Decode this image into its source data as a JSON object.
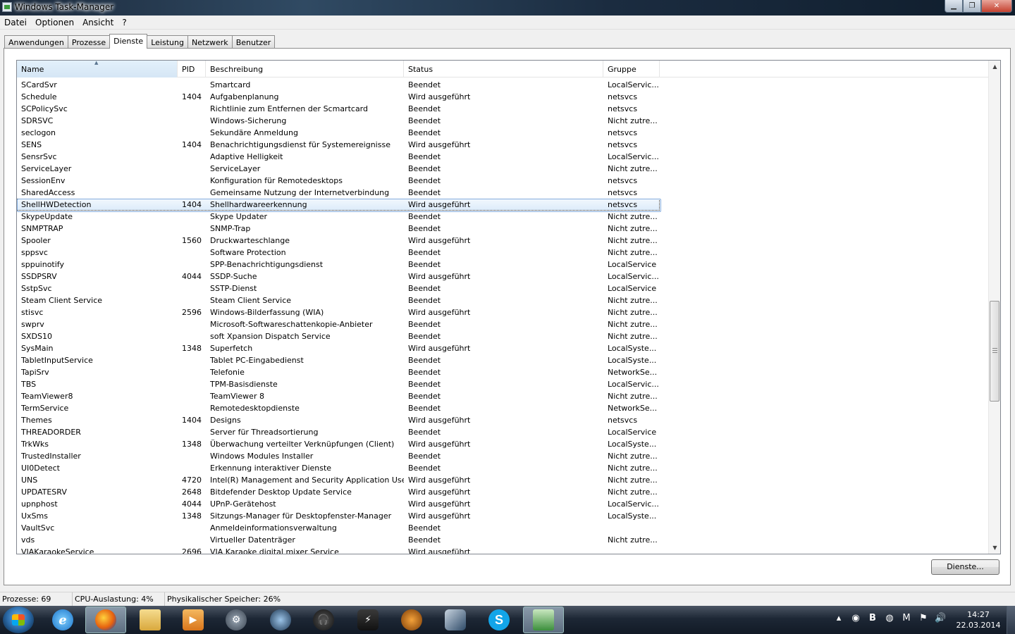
{
  "window": {
    "title": "Windows Task-Manager"
  },
  "menu": [
    "Datei",
    "Optionen",
    "Ansicht",
    "?"
  ],
  "tabs": [
    "Anwendungen",
    "Prozesse",
    "Dienste",
    "Leistung",
    "Netzwerk",
    "Benutzer"
  ],
  "active_tab": "Dienste",
  "columns": {
    "name": "Name",
    "pid": "PID",
    "desc": "Beschreibung",
    "status": "Status",
    "group": "Gruppe"
  },
  "services": [
    {
      "name": "SCardSvr",
      "pid": "",
      "desc": "Smartcard",
      "status": "Beendet",
      "group": "LocalServic..."
    },
    {
      "name": "Schedule",
      "pid": "1404",
      "desc": "Aufgabenplanung",
      "status": "Wird ausgeführt",
      "group": "netsvcs"
    },
    {
      "name": "SCPolicySvc",
      "pid": "",
      "desc": "Richtlinie zum Entfernen der Scmartcard",
      "status": "Beendet",
      "group": "netsvcs"
    },
    {
      "name": "SDRSVC",
      "pid": "",
      "desc": "Windows-Sicherung",
      "status": "Beendet",
      "group": "Nicht zutre..."
    },
    {
      "name": "seclogon",
      "pid": "",
      "desc": "Sekundäre Anmeldung",
      "status": "Beendet",
      "group": "netsvcs"
    },
    {
      "name": "SENS",
      "pid": "1404",
      "desc": "Benachrichtigungsdienst für Systemereignisse",
      "status": "Wird ausgeführt",
      "group": "netsvcs"
    },
    {
      "name": "SensrSvc",
      "pid": "",
      "desc": "Adaptive Helligkeit",
      "status": "Beendet",
      "group": "LocalServic..."
    },
    {
      "name": "ServiceLayer",
      "pid": "",
      "desc": "ServiceLayer",
      "status": "Beendet",
      "group": "Nicht zutre..."
    },
    {
      "name": "SessionEnv",
      "pid": "",
      "desc": "Konfiguration für Remotedesktops",
      "status": "Beendet",
      "group": "netsvcs"
    },
    {
      "name": "SharedAccess",
      "pid": "",
      "desc": "Gemeinsame Nutzung der Internetverbindung",
      "status": "Beendet",
      "group": "netsvcs"
    },
    {
      "name": "ShellHWDetection",
      "pid": "1404",
      "desc": "Shellhardwareerkennung",
      "status": "Wird ausgeführt",
      "group": "netsvcs",
      "selected": true
    },
    {
      "name": "SkypeUpdate",
      "pid": "",
      "desc": "Skype Updater",
      "status": "Beendet",
      "group": "Nicht zutre..."
    },
    {
      "name": "SNMPTRAP",
      "pid": "",
      "desc": "SNMP-Trap",
      "status": "Beendet",
      "group": "Nicht zutre..."
    },
    {
      "name": "Spooler",
      "pid": "1560",
      "desc": "Druckwarteschlange",
      "status": "Wird ausgeführt",
      "group": "Nicht zutre..."
    },
    {
      "name": "sppsvc",
      "pid": "",
      "desc": "Software Protection",
      "status": "Beendet",
      "group": "Nicht zutre..."
    },
    {
      "name": "sppuinotify",
      "pid": "",
      "desc": "SPP-Benachrichtigungsdienst",
      "status": "Beendet",
      "group": "LocalService"
    },
    {
      "name": "SSDPSRV",
      "pid": "4044",
      "desc": "SSDP-Suche",
      "status": "Wird ausgeführt",
      "group": "LocalServic..."
    },
    {
      "name": "SstpSvc",
      "pid": "",
      "desc": "SSTP-Dienst",
      "status": "Beendet",
      "group": "LocalService"
    },
    {
      "name": "Steam Client Service",
      "pid": "",
      "desc": "Steam Client Service",
      "status": "Beendet",
      "group": "Nicht zutre..."
    },
    {
      "name": "stisvc",
      "pid": "2596",
      "desc": "Windows-Bilderfassung (WIA)",
      "status": "Wird ausgeführt",
      "group": "Nicht zutre..."
    },
    {
      "name": "swprv",
      "pid": "",
      "desc": "Microsoft-Softwareschattenkopie-Anbieter",
      "status": "Beendet",
      "group": "Nicht zutre..."
    },
    {
      "name": "SXDS10",
      "pid": "",
      "desc": "soft Xpansion Dispatch Service",
      "status": "Beendet",
      "group": "Nicht zutre..."
    },
    {
      "name": "SysMain",
      "pid": "1348",
      "desc": "Superfetch",
      "status": "Wird ausgeführt",
      "group": "LocalSyste..."
    },
    {
      "name": "TabletInputService",
      "pid": "",
      "desc": "Tablet PC-Eingabedienst",
      "status": "Beendet",
      "group": "LocalSyste..."
    },
    {
      "name": "TapiSrv",
      "pid": "",
      "desc": "Telefonie",
      "status": "Beendet",
      "group": "NetworkSe..."
    },
    {
      "name": "TBS",
      "pid": "",
      "desc": "TPM-Basisdienste",
      "status": "Beendet",
      "group": "LocalServic..."
    },
    {
      "name": "TeamViewer8",
      "pid": "",
      "desc": "TeamViewer 8",
      "status": "Beendet",
      "group": "Nicht zutre..."
    },
    {
      "name": "TermService",
      "pid": "",
      "desc": "Remotedesktopdienste",
      "status": "Beendet",
      "group": "NetworkSe..."
    },
    {
      "name": "Themes",
      "pid": "1404",
      "desc": "Designs",
      "status": "Wird ausgeführt",
      "group": "netsvcs"
    },
    {
      "name": "THREADORDER",
      "pid": "",
      "desc": "Server für Threadsortierung",
      "status": "Beendet",
      "group": "LocalService"
    },
    {
      "name": "TrkWks",
      "pid": "1348",
      "desc": "Überwachung verteilter Verknüpfungen (Client)",
      "status": "Wird ausgeführt",
      "group": "LocalSyste..."
    },
    {
      "name": "TrustedInstaller",
      "pid": "",
      "desc": "Windows Modules Installer",
      "status": "Beendet",
      "group": "Nicht zutre..."
    },
    {
      "name": "UI0Detect",
      "pid": "",
      "desc": "Erkennung interaktiver Dienste",
      "status": "Beendet",
      "group": "Nicht zutre..."
    },
    {
      "name": "UNS",
      "pid": "4720",
      "desc": "Intel(R) Management and Security Application User N...",
      "status": "Wird ausgeführt",
      "group": "Nicht zutre..."
    },
    {
      "name": "UPDATESRV",
      "pid": "2648",
      "desc": "Bitdefender Desktop Update Service",
      "status": "Wird ausgeführt",
      "group": "Nicht zutre..."
    },
    {
      "name": "upnphost",
      "pid": "4044",
      "desc": "UPnP-Gerätehost",
      "status": "Wird ausgeführt",
      "group": "LocalServic..."
    },
    {
      "name": "UxSms",
      "pid": "1348",
      "desc": "Sitzungs-Manager für Desktopfenster-Manager",
      "status": "Wird ausgeführt",
      "group": "LocalSyste..."
    },
    {
      "name": "VaultSvc",
      "pid": "",
      "desc": "Anmeldeinformationsverwaltung",
      "status": "Beendet",
      "group": ""
    },
    {
      "name": "vds",
      "pid": "",
      "desc": "Virtueller Datenträger",
      "status": "Beendet",
      "group": "Nicht zutre..."
    },
    {
      "name": "VIAKaraokeService",
      "pid": "2696",
      "desc": "VIA Karaoke digital mixer Service",
      "status": "Wird ausgeführt",
      "group": ""
    }
  ],
  "services_button": "Dienste...",
  "statusbar": {
    "processes": "Prozesse: 69",
    "cpu": "CPU-Auslastung: 4%",
    "memory": "Physikalischer Speicher: 26%"
  },
  "taskbar": {
    "apps": [
      "internet-explorer-icon",
      "firefox-icon",
      "explorer-icon",
      "media-player-icon",
      "steam-icon",
      "teamspeak-icon",
      "headset-icon",
      "speedfan-icon",
      "swtor-icon",
      "game-icon",
      "skype-icon",
      "task-manager-icon"
    ],
    "clock_time": "14:27",
    "clock_date": "22.03.2014"
  },
  "scroll_position": 0.62,
  "colors": {
    "selection": "#dcebfa",
    "titlebar": "#1c2a3c"
  }
}
